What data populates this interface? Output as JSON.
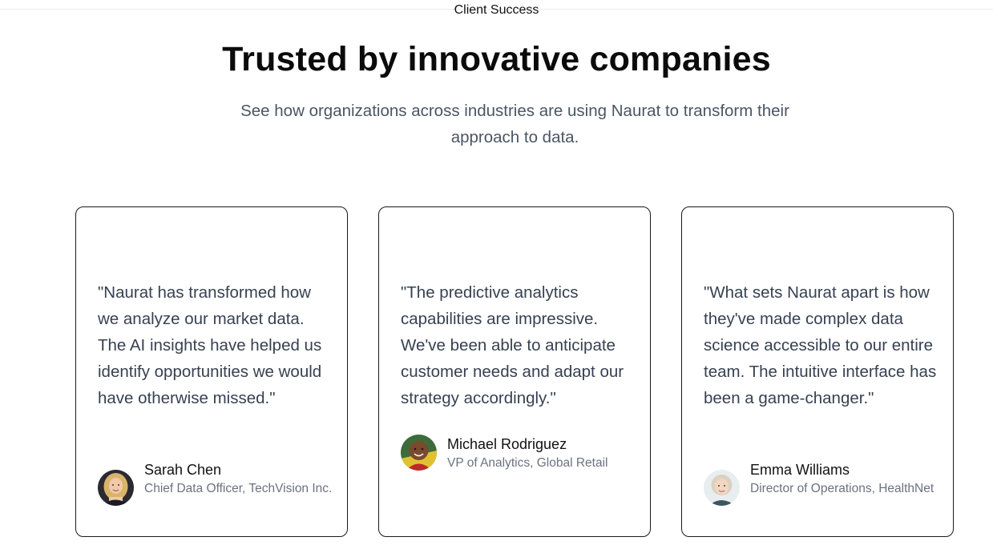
{
  "section": {
    "eyebrow": "Client Success",
    "title": "Trusted by innovative companies",
    "subtitle": "See how organizations across industries are using Naurat to transform their approach to data."
  },
  "testimonials": [
    {
      "quote": "\"Naurat has transformed how we analyze our market data. The AI insights have helped us identify opportunities we would have otherwise missed.\"",
      "name": "Sarah Chen",
      "role": "Chief Data Officer, TechVision Inc.",
      "avatar": "avatar-photo-woman-blonde"
    },
    {
      "quote": "\"The predictive analytics capabilities are impressive. We've been able to anticipate customer needs and adapt our strategy accordingly.\"",
      "name": "Michael Rodriguez",
      "role": "VP of Analytics, Global Retail",
      "avatar": "avatar-photo-man"
    },
    {
      "quote": "\"What sets Naurat apart is how they've made complex data science accessible to our entire team. The intuitive interface has been a game-changer.\"",
      "name": "Emma Williams",
      "role": "Director of Operations, HealthNet",
      "avatar": "avatar-photo-woman-grey"
    }
  ],
  "colors": {
    "heading": "#0b0b0b",
    "body_text": "#374151",
    "muted_text": "#6b7280",
    "card_border": "#1a1a1a",
    "background": "#ffffff"
  }
}
